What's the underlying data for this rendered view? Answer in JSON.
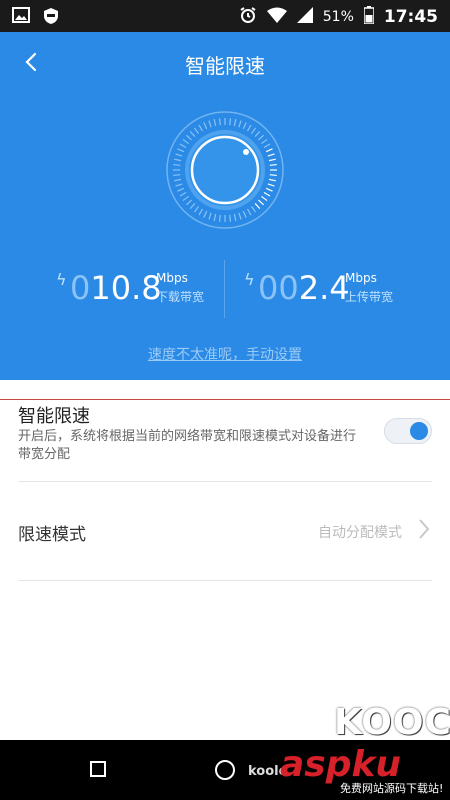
{
  "status_bar": {
    "battery_percent": "51%",
    "time": "17:45",
    "left_icons": [
      "image-icon",
      "shield-app-icon"
    ],
    "right_icons": [
      "alarm-icon",
      "wifi-icon",
      "signal-icon",
      "battery-icon"
    ]
  },
  "header": {
    "title": "智能限速",
    "back_icon": "chevron-left-icon",
    "accent_color": "#2a8ae6"
  },
  "speeds": {
    "download": {
      "prefix": "0",
      "value": "10.8",
      "unit": "Mbps",
      "label": "下载带宽"
    },
    "upload": {
      "prefix": "00",
      "value": "2.4",
      "unit": "Mbps",
      "label": "上传带宽"
    }
  },
  "manual_link": "速度不太准呢，手动设置",
  "smart_limit": {
    "title": "智能限速",
    "description": "开启后，系统将根据当前的网络带宽和限速模式对设备进行带宽分配",
    "enabled": true
  },
  "limit_mode": {
    "title": "限速模式",
    "value": "自动分配模式"
  },
  "watermarks": {
    "kooc": "KOOC",
    "kool": "koolc",
    "aspku": "aspku",
    "subtitle": "免费网站源码下载站!"
  }
}
